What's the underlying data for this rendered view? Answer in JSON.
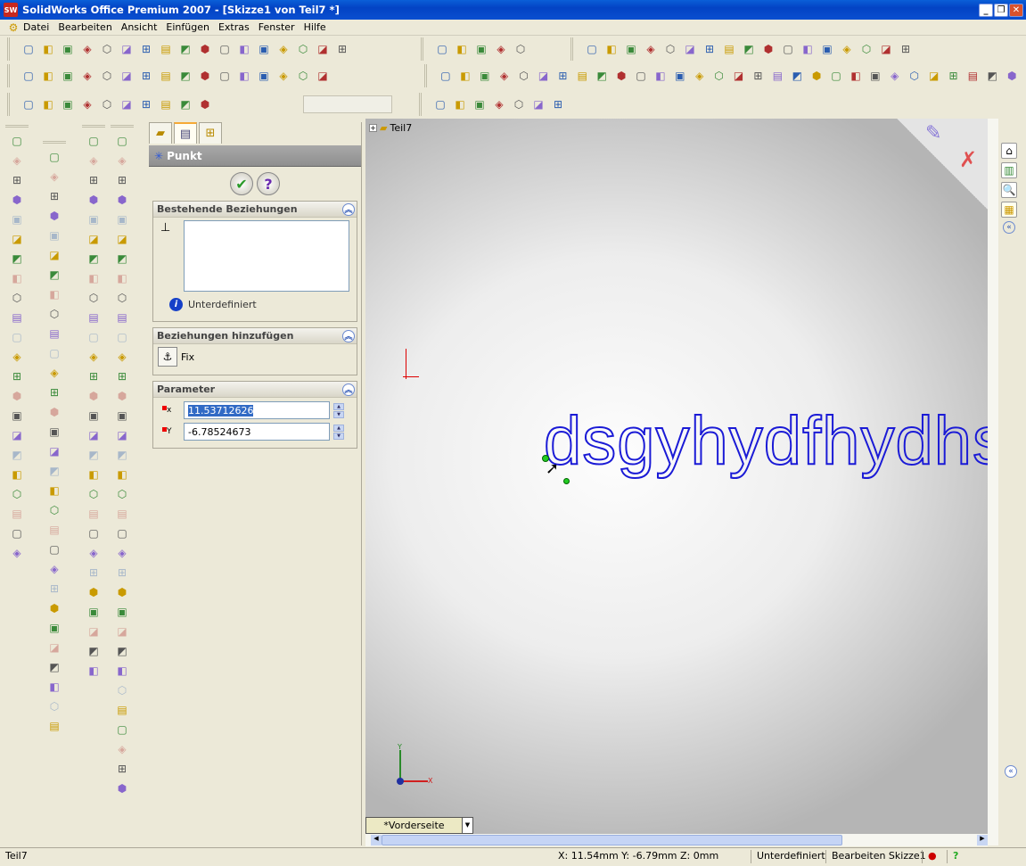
{
  "window": {
    "title": "SolidWorks Office Premium 2007 - [Skizze1 von Teil7 *]",
    "logo": "SW",
    "min": "_",
    "restore": "❐",
    "close": "✕"
  },
  "menu": [
    "Datei",
    "Bearbeiten",
    "Ansicht",
    "Einfügen",
    "Extras",
    "Fenster",
    "Hilfe"
  ],
  "toolbars": {
    "standard": [
      "new-document",
      "open-folder",
      "save",
      "print-setup",
      "properties",
      "print",
      "print-preview",
      "undo",
      "redo",
      "select",
      "selection-filter",
      "traffic-light",
      "grid",
      "view-layout",
      "options",
      "help",
      "camera"
    ],
    "macro": [
      "run",
      "stop",
      "record",
      "new-macro",
      "edit-macro",
      "cancel",
      "toolbox",
      "gear",
      "lamp",
      "user-run",
      "clock",
      "box",
      "boxes",
      "parts",
      "user-a",
      "user-b"
    ],
    "tools": [
      "spell-check",
      "measure",
      "mass-properties",
      "section-properties",
      "check",
      "statistics",
      "sum",
      "deviation",
      "spreadsheet",
      "analysis"
    ],
    "sketch": [
      "sketch-select",
      "line",
      "point",
      "smart-dimension",
      "dot"
    ],
    "view": [
      "zoom-fit",
      "zoom-area",
      "zoom-prev",
      "zoom-in-out",
      "zoom-selection",
      "rotate",
      "pan",
      "roll",
      "standard-views",
      "wireframe",
      "hidden-lines",
      "hidden-gray",
      "shaded-edges",
      "shaded",
      "perspective",
      "section-view",
      "render"
    ],
    "relations": [
      "display-relations",
      "add-relation",
      "smart",
      "cursor",
      "relation-a",
      "relation-b",
      "relation-c",
      "relation-d",
      "relation-e",
      "relation-f",
      "relation-g",
      "relation-h",
      "relation-i",
      "relation-j",
      "relation-k",
      "relation-l",
      "relation-m",
      "relation-n",
      "relation-o",
      "relation-p",
      "relation-q",
      "relation-r",
      "relation-s",
      "relation-t",
      "relation-u",
      "relation-v",
      "relation-w",
      "relation-x",
      "relation-y",
      "relation-z"
    ],
    "misc": [
      "new-sketch",
      "sketch-b",
      "sketch-c",
      "sketch-d",
      "sketch-e",
      "sketch-f",
      "sketch-g"
    ]
  },
  "property_manager": {
    "tabs": [
      "feature-manager",
      "property-manager",
      "configuration-manager"
    ],
    "title": "Punkt",
    "ok": "✔",
    "help": "?",
    "existing_relations": {
      "title": "Bestehende Beziehungen",
      "status": "Unterdefiniert"
    },
    "add_relations": {
      "title": "Beziehungen hinzufügen",
      "fix_label": "Fix"
    },
    "parameters": {
      "title": "Parameter",
      "x_label": "x",
      "x_value": "11.53712626",
      "y_label": "Y",
      "y_value": "-6.78524673"
    }
  },
  "graphics": {
    "tree_root": "Teil7",
    "sketch_text": "dsgyhydfhydhsy",
    "view_name": "*Vorderseite",
    "axis_x": "X",
    "axis_y": "Y"
  },
  "status": {
    "left": "Teil7",
    "coords": "X: 11.54mm  Y: -6.79mm  Z: 0mm",
    "state": "Unterdefiniert",
    "mode": "Bearbeiten Skizze1",
    "help": "?"
  }
}
